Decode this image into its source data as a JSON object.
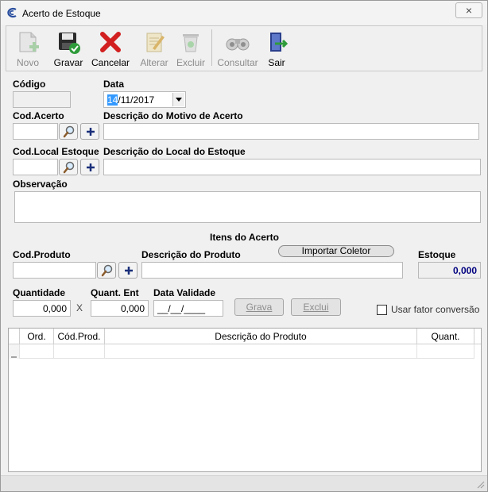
{
  "window": {
    "title": "Acerto de Estoque",
    "close_symbol": "×"
  },
  "toolbar": {
    "novo": "Novo",
    "gravar": "Gravar",
    "cancelar": "Cancelar",
    "alterar": "Alterar",
    "excluir": "Excluir",
    "consultar": "Consultar",
    "sair": "Sair"
  },
  "form": {
    "codigo_label": "Código",
    "codigo_value": "",
    "data_label": "Data",
    "data_value_selected": "14",
    "data_value_rest": "/11/2017",
    "cod_acerto_label": "Cod.Acerto",
    "cod_acerto_value": "",
    "desc_motivo_label": "Descrição do Motivo de Acerto",
    "desc_motivo_value": "",
    "cod_local_label": "Cod.Local Estoque",
    "cod_local_value": "",
    "desc_local_label": "Descrição do Local do Estoque",
    "desc_local_value": "",
    "observacao_label": "Observação",
    "observacao_value": ""
  },
  "itens": {
    "section_title": "Itens do Acerto",
    "cod_produto_label": "Cod.Produto",
    "cod_produto_value": "",
    "desc_produto_label": "Descrição do Produto",
    "desc_produto_value": "",
    "importar_coletor_label": "Importar Coletor",
    "estoque_label": "Estoque",
    "estoque_value": "0,000",
    "quantidade_label": "Quantidade",
    "quantidade_value": "0,000",
    "multiply_symbol": "X",
    "quant_ent_label": "Quant. Ent",
    "quant_ent_value": "0,000",
    "data_validade_label": "Data Validade",
    "data_validade_value": "__/__/____",
    "grava_label": "Grava",
    "exclui_label": "Exclui",
    "usar_fator_label": "Usar fator conversão",
    "usar_fator_checked": false
  },
  "grid": {
    "columns": [
      "Ord.",
      "Cód.Prod.",
      "Descrição do Produto",
      "Quant."
    ],
    "rows": []
  },
  "colors": {
    "selection": "#3399ff",
    "estoque_text": "#000080",
    "cancel_red": "#d21f1f",
    "save_green": "#2e9b3a"
  }
}
